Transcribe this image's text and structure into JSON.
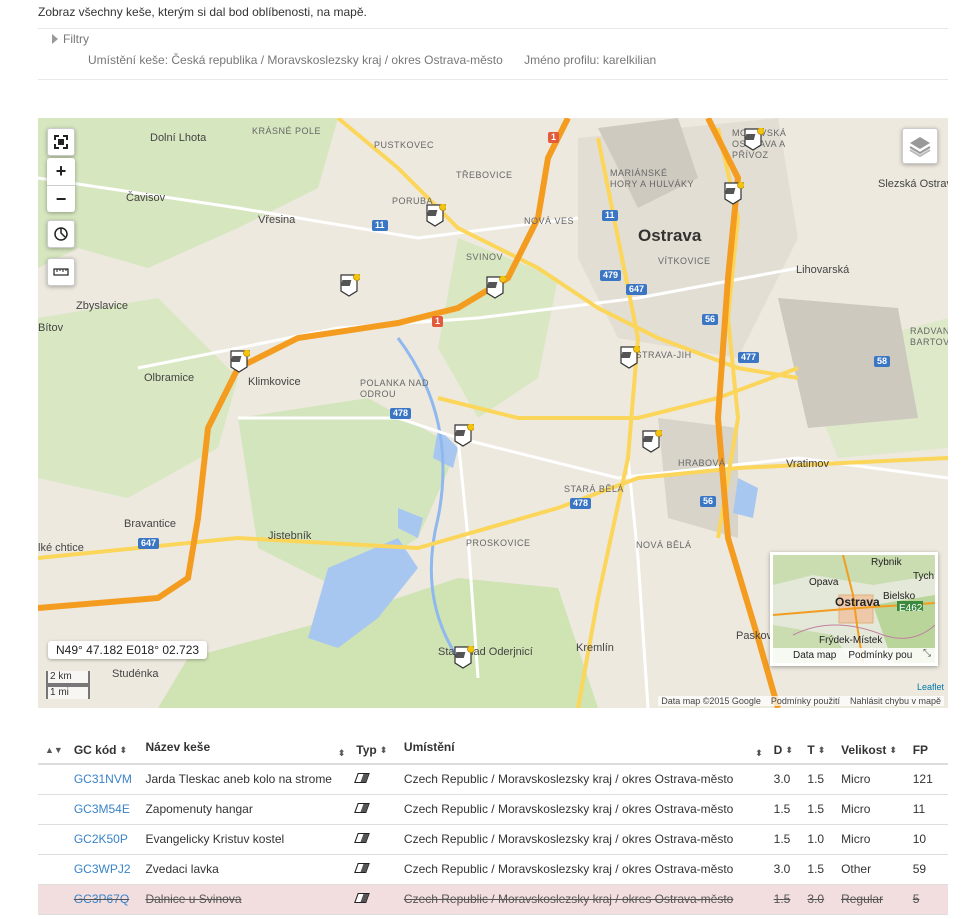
{
  "intro": "Zobraz všechny keše, kterým si dal bod oblíbenosti, na mapě.",
  "filters": {
    "toggle": "Filtry",
    "location": "Umístění keše: Česká republika / Moravskoslezsky kraj / okres Ostrava-město",
    "profile": "Jméno profilu: karelkilian"
  },
  "map": {
    "coords": "N49° 47.182 E018° 02.723",
    "scale_km": "2 km",
    "scale_mi": "1 mi",
    "attribution": [
      "Data map ©2015 Google",
      "Podmínky použití",
      "Nahlásit chybu v mapě"
    ],
    "leaflet": "Leaflet",
    "minimap_links": [
      "Data map",
      "Podmínky pou"
    ],
    "minimap_towns": [
      "Rybnik",
      "Opava",
      "Ostrava",
      "Bielsko",
      "Frýdek-Místek",
      "Tych",
      "E462"
    ],
    "towns": [
      {
        "name": "Ostrava",
        "big": true
      },
      {
        "name": "Dolní Lhota"
      },
      {
        "name": "Čavisov"
      },
      {
        "name": "Vřesina"
      },
      {
        "name": "Zbyslavice"
      },
      {
        "name": "Bítov"
      },
      {
        "name": "Olbramice"
      },
      {
        "name": "Klimkovice"
      },
      {
        "name": "Bravantice"
      },
      {
        "name": "Jistebník"
      },
      {
        "name": "Studénka"
      },
      {
        "name": "Kremlín"
      },
      {
        "name": "Vratimov"
      },
      {
        "name": "Paskov"
      },
      {
        "name": "Stará Bělá"
      },
      {
        "name": "Proskovice"
      },
      {
        "name": "Nová Bělá"
      },
      {
        "name": "Hrabová"
      },
      {
        "name": "Vítkovice"
      },
      {
        "name": "Svinov"
      },
      {
        "name": "Poruba"
      },
      {
        "name": "Mariánské hory a Hulváky"
      },
      {
        "name": "Moravská Ostrava a Přívoz"
      },
      {
        "name": "Ostrava-Jih"
      },
      {
        "name": "Radvanice a Bartovice"
      },
      {
        "name": "Polanka nad Odrou"
      },
      {
        "name": "Krásné Pole"
      },
      {
        "name": "Pustkovec"
      },
      {
        "name": "Třebovice"
      },
      {
        "name": "Nová Ves"
      },
      {
        "name": "Lihovarská"
      },
      {
        "name": "Slezská Ostrava"
      },
      {
        "name": "Staré nad Oderjnicí"
      },
      {
        "name": "lké chtice"
      }
    ],
    "road_labels": [
      "11",
      "1",
      "647",
      "479",
      "478",
      "56",
      "477",
      "58"
    ]
  },
  "table": {
    "headers": [
      "GC kód",
      "Název keše",
      "Typ",
      "Umístění",
      "D",
      "T",
      "Velikost",
      "FP"
    ],
    "rows": [
      {
        "code": "GC31NVM",
        "name": "Jarda Tleskac aneb kolo na strome",
        "location": "Czech Republic / Moravskoslezsky kraj / okres Ostrava-město",
        "d": "3.0",
        "t": "1.5",
        "size": "Micro",
        "fp": "121",
        "disabled": false
      },
      {
        "code": "GC3M54E",
        "name": "Zapomenuty hangar",
        "location": "Czech Republic / Moravskoslezsky kraj / okres Ostrava-město",
        "d": "1.5",
        "t": "1.5",
        "size": "Micro",
        "fp": "11",
        "disabled": false
      },
      {
        "code": "GC2K50P",
        "name": "Evangelicky Kristuv kostel",
        "location": "Czech Republic / Moravskoslezsky kraj / okres Ostrava-město",
        "d": "1.5",
        "t": "1.0",
        "size": "Micro",
        "fp": "10",
        "disabled": false
      },
      {
        "code": "GC3WPJ2",
        "name": "Zvedaci lavka",
        "location": "Czech Republic / Moravskoslezsky kraj / okres Ostrava-město",
        "d": "3.0",
        "t": "1.5",
        "size": "Other",
        "fp": "59",
        "disabled": false
      },
      {
        "code": "GC3P67Q",
        "name": "Dalnice u Svinova",
        "location": "Czech Republic / Moravskoslezsky kraj / okres Ostrava-město",
        "d": "1.5",
        "t": "3.0",
        "size": "Regular",
        "fp": "5",
        "disabled": true
      }
    ]
  },
  "colors": {
    "link": "#3a83c8",
    "disabled_row": "#f2dede",
    "highway": "#f7a52b",
    "water": "#8fb8ee",
    "green": "#cfe3b3"
  }
}
